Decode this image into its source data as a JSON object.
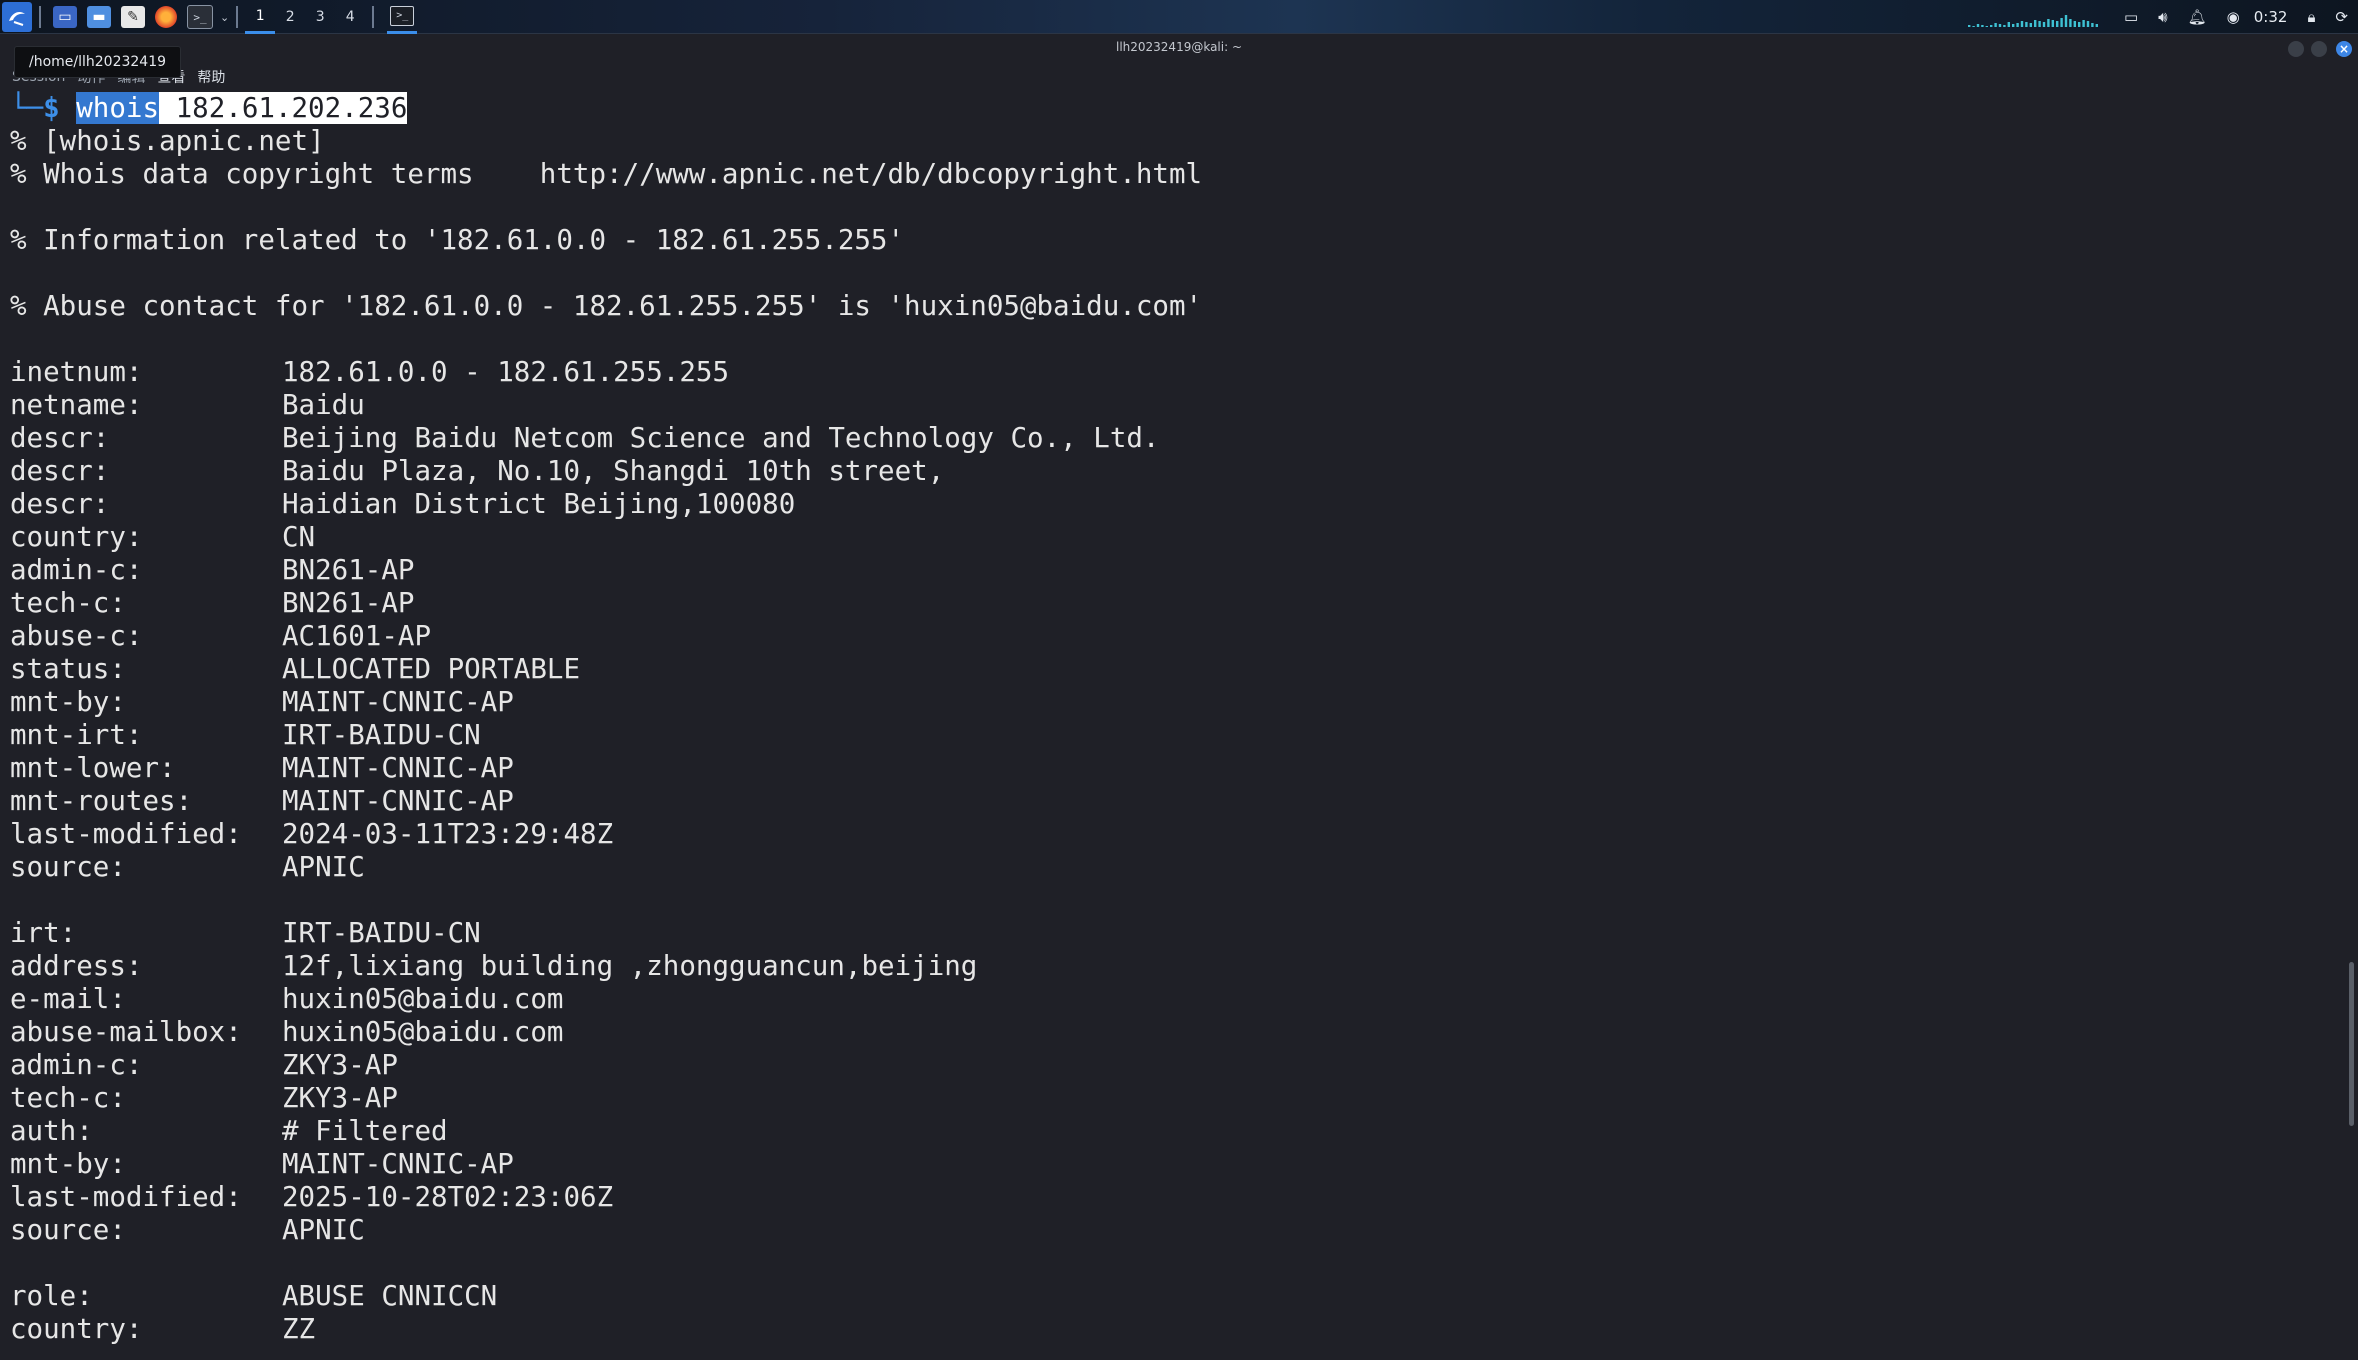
{
  "panel": {
    "workspaces": [
      "1",
      "2",
      "3",
      "4"
    ],
    "active_workspace": "1",
    "launchers": [
      {
        "name": "terminal-emulator-icon"
      },
      {
        "name": "file-manager-icon"
      },
      {
        "name": "text-editor-icon"
      },
      {
        "name": "firefox-icon"
      },
      {
        "name": "terminal-dropdown-icon"
      }
    ],
    "clock": "0:32",
    "colors": {
      "accent": "#3b8eea",
      "panel_bg": "#0d1520"
    }
  },
  "window": {
    "title": "llh20232419@kali: ~",
    "tooltip": "/home/llh20232419",
    "menus": [
      "Session",
      "动作",
      "编辑",
      "查看",
      "帮助"
    ]
  },
  "terminal": {
    "colors": {
      "background": "#1f2027",
      "foreground": "#e6e6e6",
      "prompt": "#3d8fe8",
      "selection": "#3478d0"
    },
    "prompt": {
      "corner": "└─",
      "symbol": "$",
      "command": "whois",
      "argument": " 182.61.202.236"
    },
    "lines": [
      {
        "text": "% [whois.apnic.net]"
      },
      {
        "text": "% Whois data copyright terms    http://www.apnic.net/db/dbcopyright.html"
      },
      {
        "text": ""
      },
      {
        "text": "% Information related to '182.61.0.0 - 182.61.255.255'"
      },
      {
        "text": ""
      },
      {
        "text": "% Abuse contact for '182.61.0.0 - 182.61.255.255' is 'huxin05@baidu.com'"
      },
      {
        "text": ""
      },
      {
        "key": "inetnum:",
        "value": "182.61.0.0 - 182.61.255.255"
      },
      {
        "key": "netname:",
        "value": "Baidu"
      },
      {
        "key": "descr:",
        "value": "Beijing Baidu Netcom Science and Technology Co., Ltd."
      },
      {
        "key": "descr:",
        "value": "Baidu Plaza, No.10, Shangdi 10th street,"
      },
      {
        "key": "descr:",
        "value": "Haidian District Beijing,100080"
      },
      {
        "key": "country:",
        "value": "CN"
      },
      {
        "key": "admin-c:",
        "value": "BN261-AP"
      },
      {
        "key": "tech-c:",
        "value": "BN261-AP"
      },
      {
        "key": "abuse-c:",
        "value": "AC1601-AP"
      },
      {
        "key": "status:",
        "value": "ALLOCATED PORTABLE"
      },
      {
        "key": "mnt-by:",
        "value": "MAINT-CNNIC-AP"
      },
      {
        "key": "mnt-irt:",
        "value": "IRT-BAIDU-CN"
      },
      {
        "key": "mnt-lower:",
        "value": "MAINT-CNNIC-AP"
      },
      {
        "key": "mnt-routes:",
        "value": "MAINT-CNNIC-AP"
      },
      {
        "key": "last-modified:",
        "value": "2024-03-11T23:29:48Z"
      },
      {
        "key": "source:",
        "value": "APNIC"
      },
      {
        "text": ""
      },
      {
        "key": "irt:",
        "value": "IRT-BAIDU-CN"
      },
      {
        "key": "address:",
        "value": "12f,lixiang building ,zhongguancun,beijing"
      },
      {
        "key": "e-mail:",
        "value": "huxin05@baidu.com"
      },
      {
        "key": "abuse-mailbox:",
        "value": "huxin05@baidu.com"
      },
      {
        "key": "admin-c:",
        "value": "ZKY3-AP"
      },
      {
        "key": "tech-c:",
        "value": "ZKY3-AP"
      },
      {
        "key": "auth:",
        "value": "# Filtered"
      },
      {
        "key": "mnt-by:",
        "value": "MAINT-CNNIC-AP"
      },
      {
        "key": "last-modified:",
        "value": "2025-10-28T02:23:06Z"
      },
      {
        "key": "source:",
        "value": "APNIC"
      },
      {
        "text": ""
      },
      {
        "key": "role:",
        "value": "ABUSE CNNICCN"
      },
      {
        "key": "country:",
        "value": "ZZ"
      }
    ]
  }
}
